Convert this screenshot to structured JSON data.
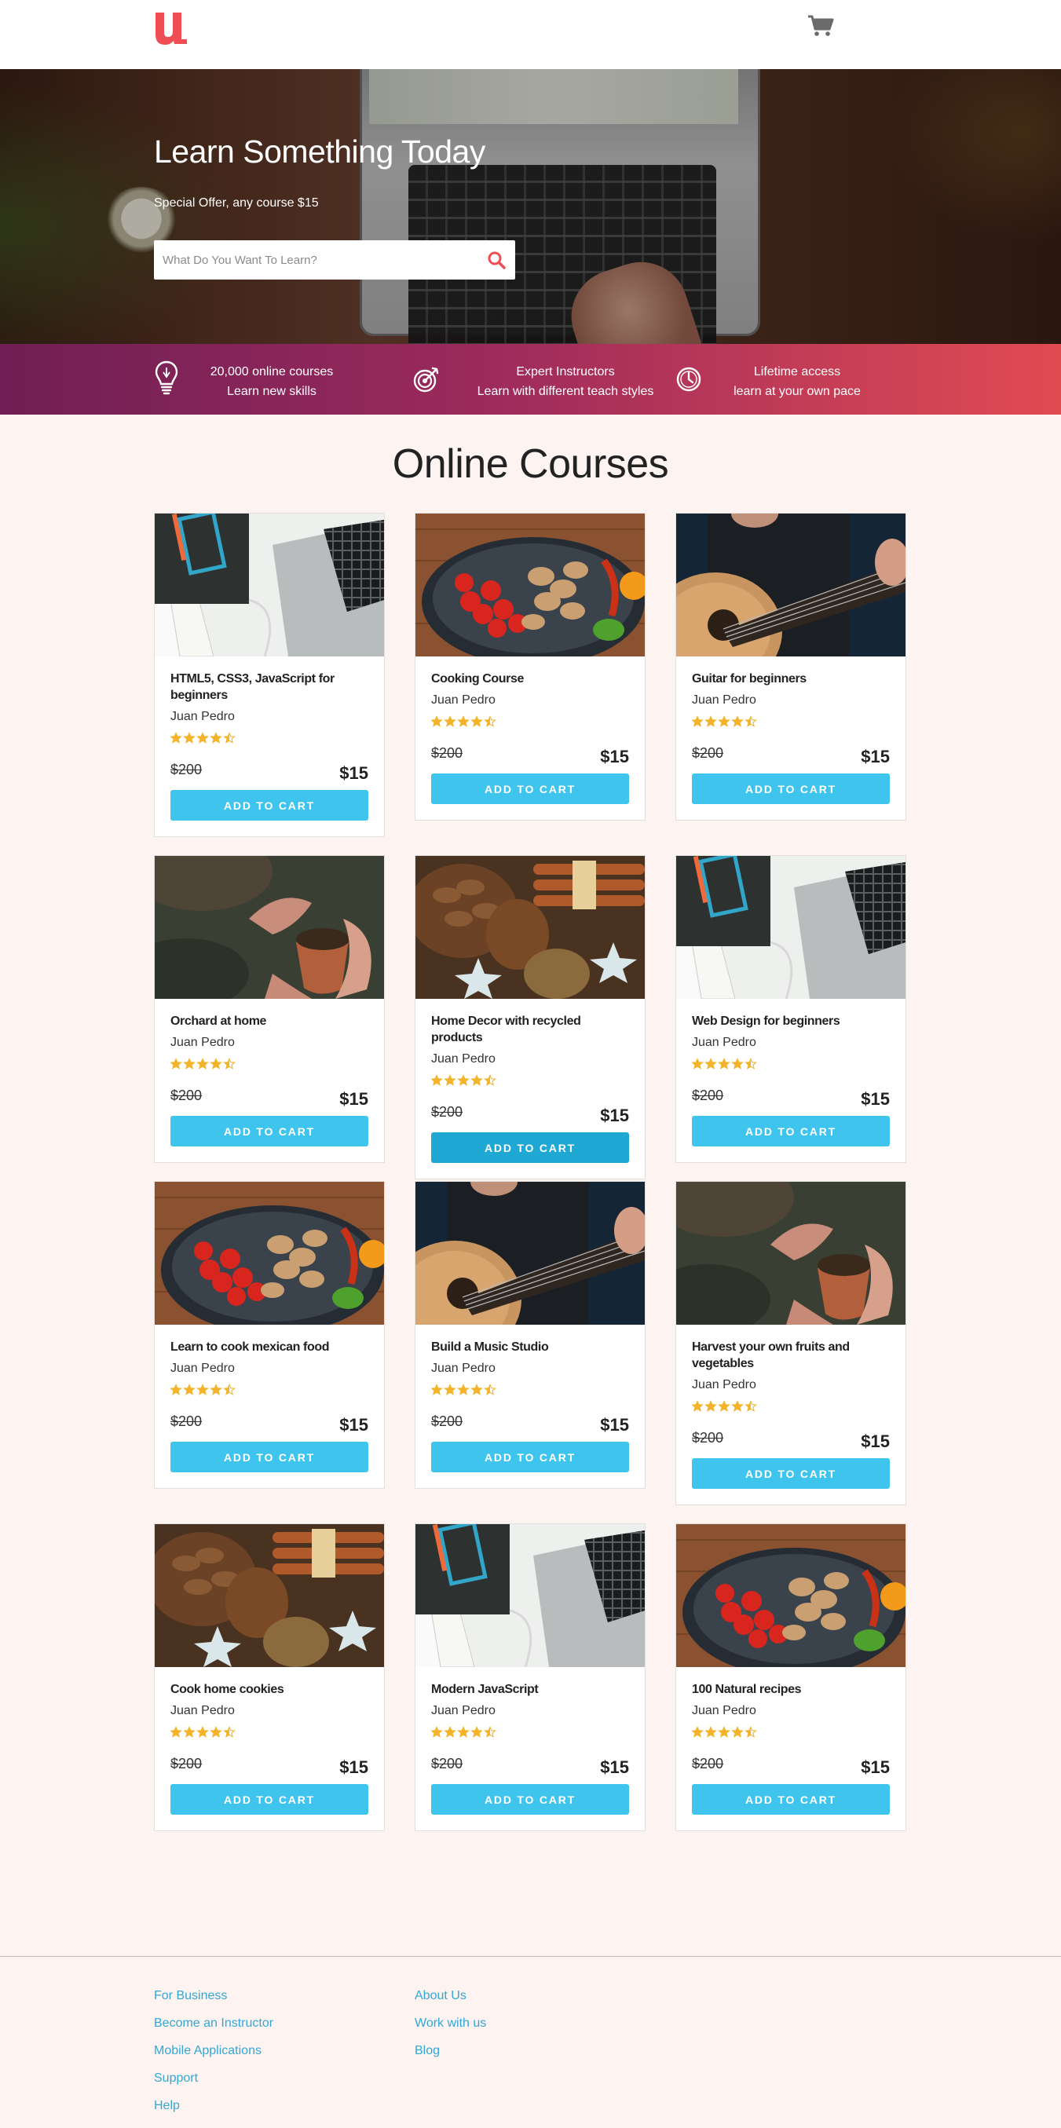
{
  "header": {
    "logo_letter": "u",
    "brand_color": "#ef4e55",
    "cart_icon": "shopping-cart-icon"
  },
  "hero": {
    "title": "Learn Something Today",
    "offer": "Special Offer, any course $15",
    "search_placeholder": "What Do You Want To Learn?",
    "search_icon": "search-icon"
  },
  "features": [
    {
      "icon": "lightbulb-icon",
      "line1": "20,000 online courses",
      "line2": "Learn new skills"
    },
    {
      "icon": "target-icon",
      "line1": "Expert Instructors",
      "line2": "Learn with different teach styles"
    },
    {
      "icon": "clock-icon",
      "line1": "Lifetime access",
      "line2": "learn at your own pace"
    }
  ],
  "courses_section": {
    "title": "Online Courses",
    "add_label": "ADD TO CART",
    "rating": 4.5,
    "star_color": "#f3b42b",
    "button_color": "#3fc4ee",
    "courses": [
      {
        "title": "HTML5, CSS3, JavaScript for beginners",
        "author": "Juan Pedro",
        "old_price": "$200",
        "price": "$15",
        "image": "laptop-notebook"
      },
      {
        "title": "Cooking Course",
        "author": "Juan Pedro",
        "old_price": "$200",
        "price": "$15",
        "image": "cooking-pan"
      },
      {
        "title": "Guitar for beginners",
        "author": "Juan Pedro",
        "old_price": "$200",
        "price": "$15",
        "image": "guitar"
      },
      {
        "title": "Orchard at home",
        "author": "Juan Pedro",
        "old_price": "$200",
        "price": "$15",
        "image": "plant-pot"
      },
      {
        "title": "Home Decor with recycled products",
        "author": "Juan Pedro",
        "old_price": "$200",
        "price": "$15",
        "image": "pinecones"
      },
      {
        "title": "Web Design for beginners",
        "author": "Juan Pedro",
        "old_price": "$200",
        "price": "$15",
        "image": "laptop-notebook"
      },
      {
        "title": "Learn to cook mexican food",
        "author": "Juan Pedro",
        "old_price": "$200",
        "price": "$15",
        "image": "cooking-pan"
      },
      {
        "title": "Build a Music Studio",
        "author": "Juan Pedro",
        "old_price": "$200",
        "price": "$15",
        "image": "guitar"
      },
      {
        "title": "Harvest your own fruits and vegetables",
        "author": "Juan Pedro",
        "old_price": "$200",
        "price": "$15",
        "image": "plant-pot"
      },
      {
        "title": "Cook home cookies",
        "author": "Juan Pedro",
        "old_price": "$200",
        "price": "$15",
        "image": "pinecones"
      },
      {
        "title": "Modern JavaScript",
        "author": "Juan Pedro",
        "old_price": "$200",
        "price": "$15",
        "image": "laptop-notebook"
      },
      {
        "title": "100 Natural recipes",
        "author": "Juan Pedro",
        "old_price": "$200",
        "price": "$15",
        "image": "cooking-pan"
      }
    ]
  },
  "footer": {
    "column1": [
      "For Business",
      "Become an Instructor",
      "Mobile Applications",
      "Support",
      "Help"
    ],
    "column2": [
      "About Us",
      "Work with us",
      "Blog"
    ],
    "link_color": "#33a7d4"
  }
}
